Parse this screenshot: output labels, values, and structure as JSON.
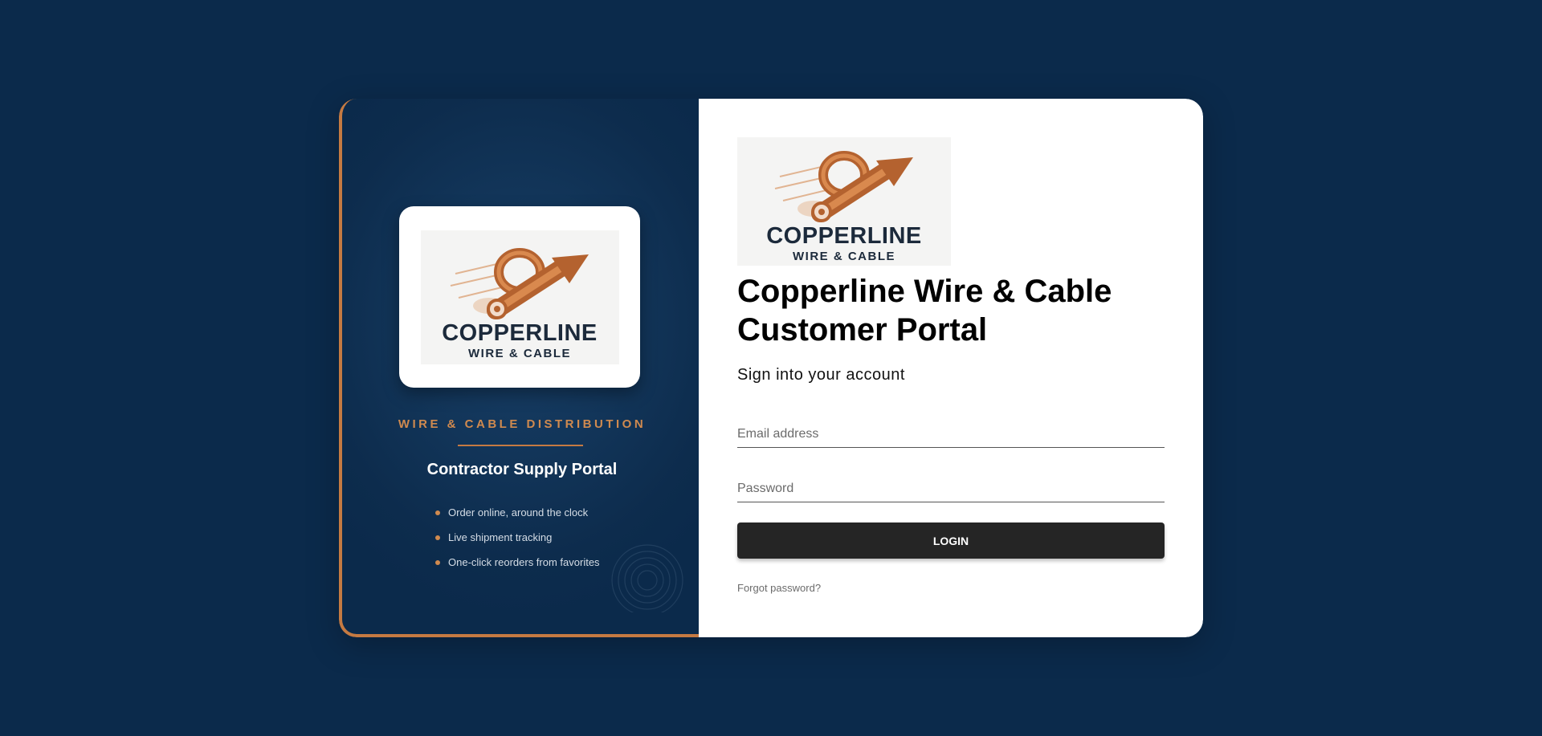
{
  "brand": {
    "logo_name": "COPPERLINE",
    "logo_sub": "WIRE & CABLE"
  },
  "left_panel": {
    "tagline": "WIRE & CABLE DISTRIBUTION",
    "portal_title": "Contractor Supply Portal",
    "features": [
      "Order online, around the clock",
      "Live shipment tracking",
      "One-click reorders from favorites"
    ]
  },
  "login": {
    "title": "Copperline Wire & Cable Customer Portal",
    "subtitle": "Sign into your account",
    "email_placeholder": "Email address",
    "password_placeholder": "Password",
    "login_label": "LOGIN",
    "forgot_label": "Forgot password?"
  },
  "colors": {
    "page_background": "#0b2a4b",
    "accent_copper": "#c57a42",
    "button_dark": "#252525",
    "panel_white": "#ffffff"
  },
  "icons": {
    "logo_graphic": "copper-wire-coil-arrow-icon",
    "bullet": "bullet-dot-icon",
    "decor": "concentric-rings-icon"
  }
}
